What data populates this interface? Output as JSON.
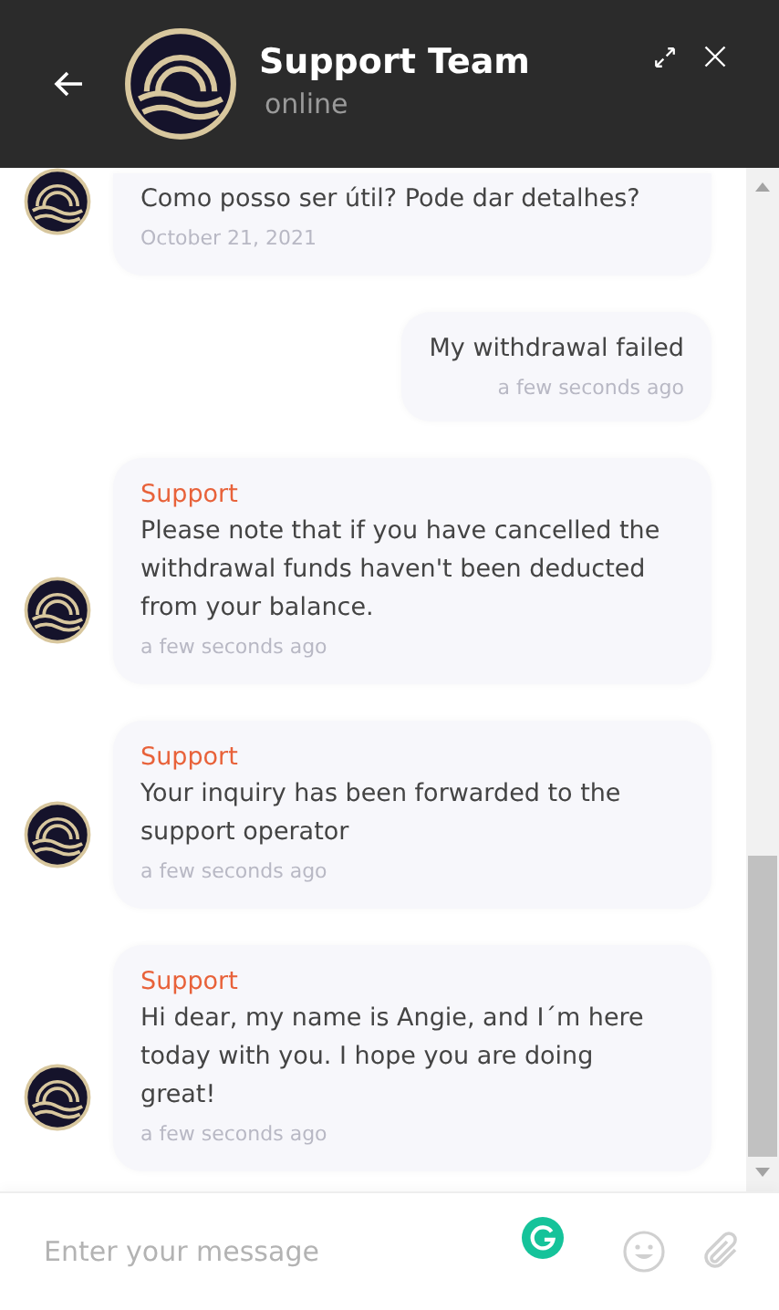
{
  "header": {
    "title": "Support Team",
    "status": "online"
  },
  "messages": [
    {
      "kind": "agent",
      "text": "Como posso ser útil? Pode dar detalhes?",
      "time": "October 21, 2021"
    },
    {
      "kind": "user",
      "text": "My withdrawal failed",
      "time": "a few seconds ago"
    },
    {
      "kind": "agent",
      "sender": "Support",
      "text": "Please note that if you have cancelled the withdrawal funds haven't been deducted from your balance.",
      "time": "a few seconds ago"
    },
    {
      "kind": "agent",
      "sender": "Support",
      "text": "Your inquiry has been forwarded to the support operator",
      "time": "a few seconds ago"
    },
    {
      "kind": "agent",
      "sender": "Support",
      "text": "Hi dear, my name is Angie, and I´m here today with you. I hope you are doing great!",
      "time": "a few seconds ago"
    }
  ],
  "composer": {
    "placeholder": "Enter your message"
  }
}
